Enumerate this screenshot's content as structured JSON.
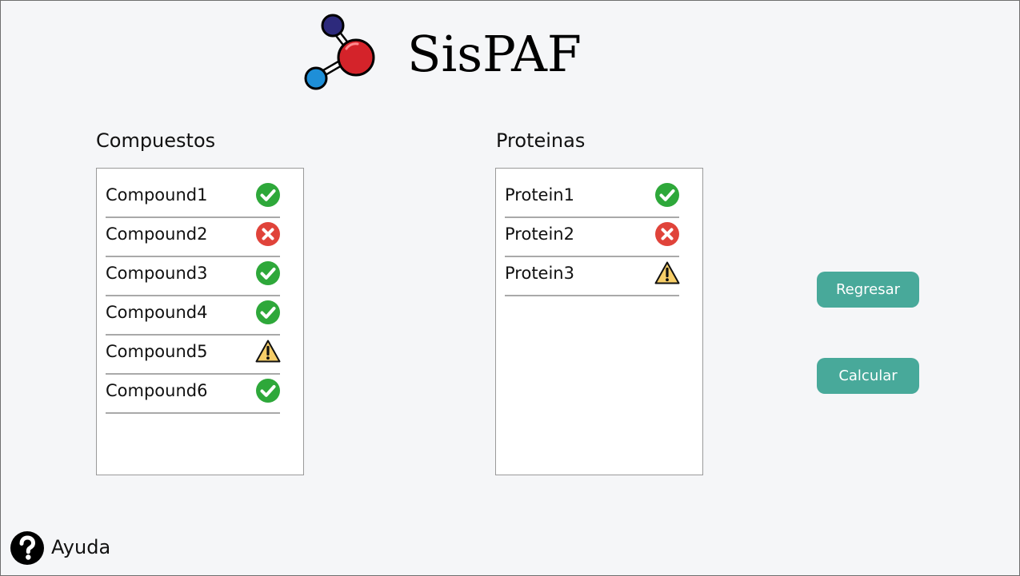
{
  "app": {
    "title": "SisPAF",
    "logo_icon": "molecule-icon"
  },
  "compounds": {
    "title": "Compuestos",
    "items": [
      {
        "label": "Compound1",
        "status": "ok"
      },
      {
        "label": "Compound2",
        "status": "error"
      },
      {
        "label": "Compound3",
        "status": "ok"
      },
      {
        "label": "Compound4",
        "status": "ok"
      },
      {
        "label": "Compound5",
        "status": "warning"
      },
      {
        "label": "Compound6",
        "status": "ok"
      }
    ]
  },
  "proteins": {
    "title": "Proteinas",
    "items": [
      {
        "label": "Protein1",
        "status": "ok"
      },
      {
        "label": "Protein2",
        "status": "error"
      },
      {
        "label": "Protein3",
        "status": "warning"
      }
    ]
  },
  "actions": {
    "back_label": "Regresar",
    "calculate_label": "Calcular"
  },
  "help": {
    "label": "Ayuda",
    "icon": "question-circle-icon"
  },
  "colors": {
    "background": "#f5f6f8",
    "button": "#48a99a",
    "ok": "#2ea83a",
    "error": "#e0433a",
    "warning": "#f7ce68",
    "atom_purple": "#2d2a7c",
    "atom_red": "#d4232a",
    "atom_blue": "#1e8fd8"
  }
}
